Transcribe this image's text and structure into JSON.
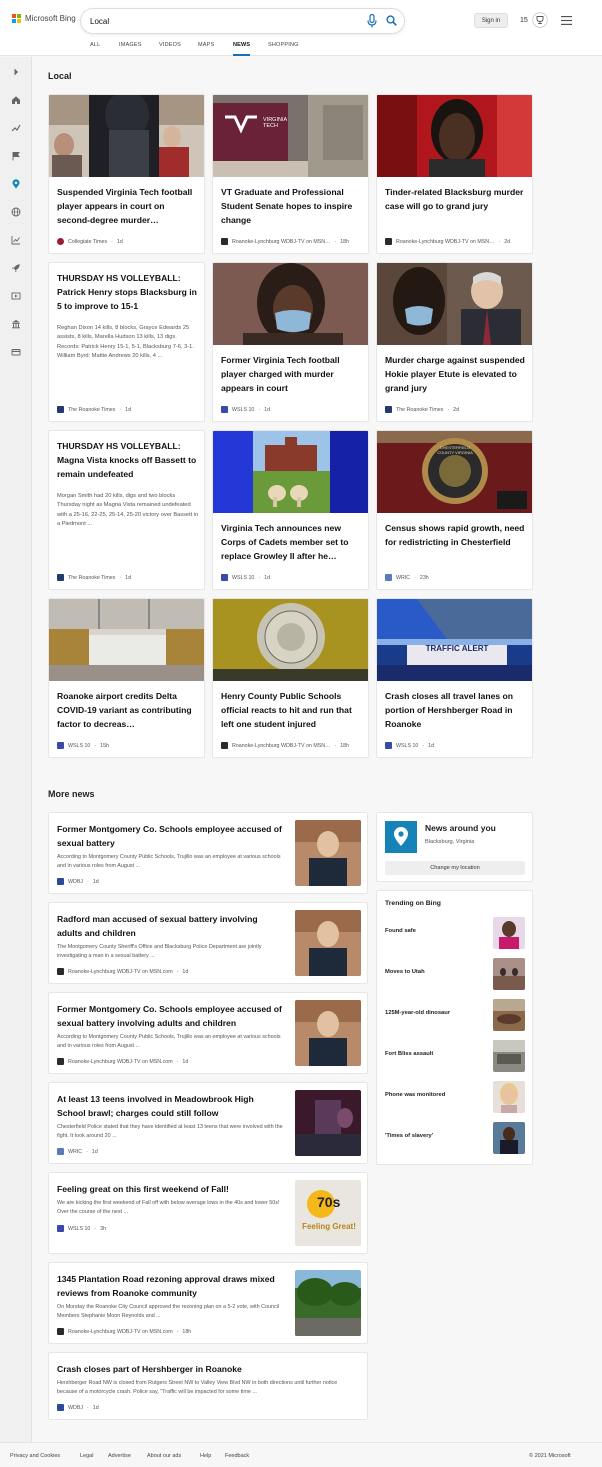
{
  "header": {
    "logo_text": "Microsoft Bing",
    "search_value": "Local",
    "signin_label": "Sign in",
    "reward_count": "15",
    "tabs": [
      "ALL",
      "IMAGES",
      "VIDEOS",
      "MAPS",
      "NEWS",
      "SHOPPING"
    ],
    "active_tab": "NEWS"
  },
  "sections": {
    "local_title": "Local",
    "more_title": "More news"
  },
  "cards": [
    {
      "title": "Suspended Virginia Tech football player appears in court on second-degree murder…",
      "snippet": "",
      "source": "Collegiate Times",
      "age": "1d"
    },
    {
      "title": "VT Graduate and Professional Student Senate hopes to inspire change",
      "snippet": "",
      "source": "Roanoke-Lynchburg WDBJ-TV on MSN…",
      "age": "18h"
    },
    {
      "title": "Tinder-related Blacksburg murder case will go to grand jury",
      "snippet": "",
      "source": "Roanoke-Lynchburg WDBJ-TV on MSN…",
      "age": "2d"
    },
    {
      "title": "THURSDAY HS VOLLEYBALL: Patrick Henry stops Blacksburg in 5 to improve to 15-1",
      "snippet": "Reghan Dixon 14 kills, 8 blocks, Grayce Edwards 25 assists, 8 kills, Marella Hudson 13 kills, 13 digs. Records: Patrick Henry 15-1, 5-1, Blacksburg 7-6, 3-1. William Byrd: Mattie Andrews 20 kills, 4 ...",
      "source": "The Roanoke Times",
      "age": "1d"
    },
    {
      "title": "Former Virginia Tech football player charged with murder appears in court",
      "snippet": "",
      "source": "WSLS 10",
      "age": "1d"
    },
    {
      "title": "Murder charge against suspended Hokie player Etute is elevated to grand jury",
      "snippet": "",
      "source": "The Roanoke Times",
      "age": "2d"
    },
    {
      "title": "THURSDAY HS VOLLEYBALL: Magna Vista knocks off Bassett to remain undefeated",
      "snippet": "Morgan Smith had 20 kills, digs and two blocks Thursday night as Magna Vista remained undefeated with a 25-16, 22-25, 25-14, 25-20 victory over Bassett in a Piedmont ...",
      "source": "The Roanoke Times",
      "age": "1d"
    },
    {
      "title": "Virginia Tech announces new Corps of Cadets member set to replace Growley II after he…",
      "snippet": "",
      "source": "WSLS 10",
      "age": "1d"
    },
    {
      "title": "Census shows rapid growth, need for redistricting in Chesterfield",
      "snippet": "",
      "source": "WRIC",
      "age": "23h"
    },
    {
      "title": "Roanoke airport credits Delta COVID-19 variant as contributing factor to decreas…",
      "snippet": "",
      "source": "WSLS 10",
      "age": "15h"
    },
    {
      "title": "Henry County Public Schools official reacts to hit and run that left one student injured",
      "snippet": "",
      "source": "Roanoke-Lynchburg WDBJ-TV on MSN…",
      "age": "18h"
    },
    {
      "title": "Crash closes all travel lanes on portion of Hershberger Road in Roanoke",
      "snippet": "",
      "source": "WSLS 10",
      "age": "1d"
    }
  ],
  "image_text": {
    "vt_banner": "VIRGINIA TECH",
    "seal": "CHESTERFIELD COUNTY VIRGINIA",
    "traffic_alert": "TRAFFIC ALERT",
    "feeling_great": "Feeling Great!",
    "seventies": "70s"
  },
  "more_news": [
    {
      "title": "Former Montgomery Co. Schools employee accused of sexual battery",
      "snippet": "According to Montgomery County Public Schools, Trujillo was an employee at various schools and in various roles from August ...",
      "source": "WDBJ",
      "age": "1d"
    },
    {
      "title": "Radford man accused of sexual battery involving adults and children",
      "snippet": "The Montgomery County Sheriff's Office and Blacksburg Police Department are jointly investigating a man in a sexual battery ...",
      "source": "Roanoke-Lynchburg WDBJ-TV on MSN.com",
      "age": "1d"
    },
    {
      "title": "Former Montgomery Co. Schools employee accused of sexual battery involving adults and children",
      "snippet": "According to Montgomery County Public Schools, Trujillo was an employee at various schools and in various roles from August ...",
      "source": "Roanoke-Lynchburg WDBJ-TV on MSN.com",
      "age": "1d"
    },
    {
      "title": "At least 13 teens involved in Meadowbrook High School brawl; charges could still follow",
      "snippet": "Chesterfield Police stated that they have identified at least 13 teens that were involved with the fight. It took around 20 ...",
      "source": "WRIC",
      "age": "1d"
    },
    {
      "title": "Feeling great on this first weekend of Fall!",
      "snippet": "We are kicking the first weekend of Fall off with below average lows in the 40s and lower 50s! Over the course of the next ...",
      "source": "WSLS 10",
      "age": "3h"
    },
    {
      "title": "1345 Plantation Road rezoning approval draws mixed reviews from Roanoke community",
      "snippet": "On Monday the Roanoke City Council approved the rezoning plan on a 5-2 vote, with Council Members Stephanie Moon Reynolds and ...",
      "source": "Roanoke-Lynchburg WDBJ-TV on MSN.com",
      "age": "18h"
    },
    {
      "title": "Crash closes part of Hershberger in Roanoke",
      "snippet": "Hershberger Road NW is closed from Rutgers Street NW to Valley View Blvd NW in both directions until further notice because of a motorcycle crash. Police say, \"Traffic will be impacted for some time ...",
      "source": "WDBJ",
      "age": "1d"
    }
  ],
  "news_around": {
    "title": "News around you",
    "location": "Blacksburg, Virginia",
    "button": "Change my location"
  },
  "trending": {
    "title": "Trending on Bing",
    "items": [
      "Found safe",
      "Moves to Utah",
      "125M-year-old dinosaur",
      "Fort Bliss assault",
      "Phone was monitored",
      "'Times of slavery'"
    ]
  },
  "footer": {
    "links": [
      "Privacy and Cookies",
      "Legal",
      "Advertise",
      "About our ads",
      "Help",
      "Feedback"
    ],
    "copyright": "© 2021 Microsoft"
  },
  "colors": {
    "accent": "#1a6fb5",
    "location_tile": "#1683b8",
    "logo": [
      "#f25022",
      "#7fba00",
      "#00a4ef",
      "#ffb900"
    ]
  }
}
